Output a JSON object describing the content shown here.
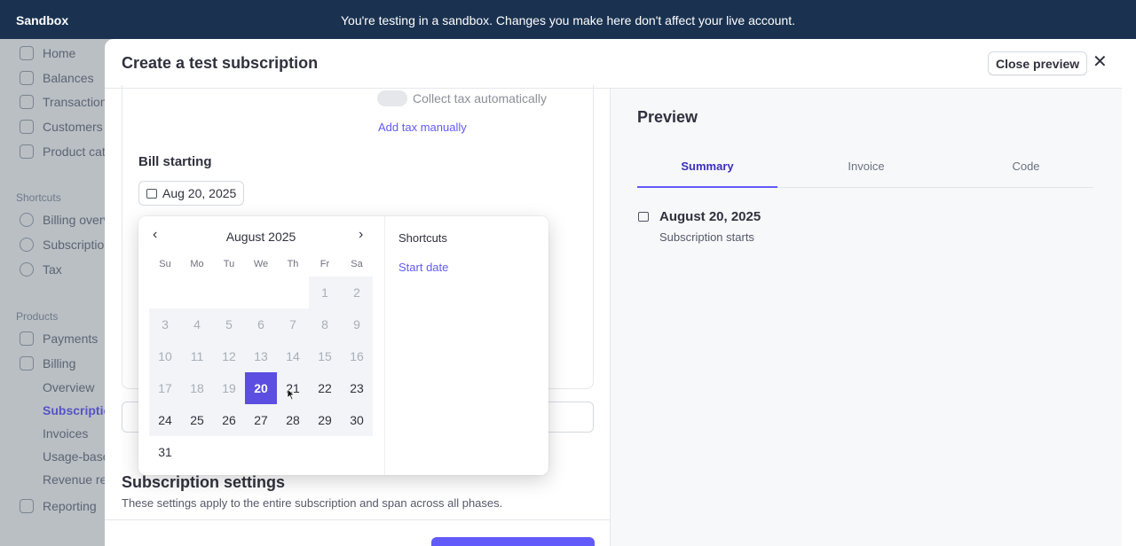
{
  "banner": {
    "brand": "Sandbox",
    "message": "You're testing in a sandbox. Changes you make here don't affect your live account."
  },
  "sidebar": {
    "items": [
      {
        "label": "Home",
        "icon": "home-icon"
      },
      {
        "label": "Balances",
        "icon": "balances-icon"
      },
      {
        "label": "Transaction",
        "icon": "transactions-icon"
      },
      {
        "label": "Customers",
        "icon": "customers-icon"
      },
      {
        "label": "Product cat",
        "icon": "product-catalog-icon"
      }
    ],
    "shortcuts_heading": "Shortcuts",
    "shortcuts": [
      {
        "label": "Billing overv",
        "icon": "clock-icon"
      },
      {
        "label": "Subscriptio",
        "icon": "clock-icon"
      },
      {
        "label": "Tax",
        "icon": "clock-icon"
      }
    ],
    "products_heading": "Products",
    "products": [
      {
        "label": "Payments",
        "icon": "payments-icon"
      },
      {
        "label": "Billing",
        "icon": "billing-icon"
      }
    ],
    "billing_sub": [
      "Overview",
      "Subscriptio",
      "Invoices",
      "Usage-base",
      "Revenue rec"
    ],
    "reporting": {
      "label": "Reporting",
      "icon": "reporting-icon"
    }
  },
  "modal": {
    "title": "Create a test subscription",
    "close_preview_label": "Close preview",
    "close_icon": "close-icon"
  },
  "form": {
    "collect_tax_label": "Collect tax automatically",
    "add_tax_label": "Add tax manually",
    "bill_starting_label": "Bill starting",
    "bill_starting_value": "Aug 20, 2025",
    "subscription_settings_title": "Subscription settings",
    "subscription_settings_desc": "These settings apply to the entire subscription and span across all phases."
  },
  "date_picker": {
    "month_label": "August 2025",
    "weekdays": [
      "Su",
      "Mo",
      "Tu",
      "We",
      "Th",
      "Fr",
      "Sa"
    ],
    "first_weekday_index": 5,
    "days_in_month": 31,
    "min_selectable_day": 20,
    "selected_day": 20,
    "shortcuts_title": "Shortcuts",
    "shortcut_items": [
      "Start date"
    ]
  },
  "preview": {
    "title": "Preview",
    "tabs": [
      {
        "label": "Summary",
        "active": true
      },
      {
        "label": "Invoice",
        "active": false
      },
      {
        "label": "Code",
        "active": false
      }
    ],
    "start_date": "August 20, 2025",
    "start_caption": "Subscription starts"
  },
  "colors": {
    "accent": "#625afa",
    "selected_day": "#5b4ee0",
    "banner_bg": "#1a3250"
  }
}
